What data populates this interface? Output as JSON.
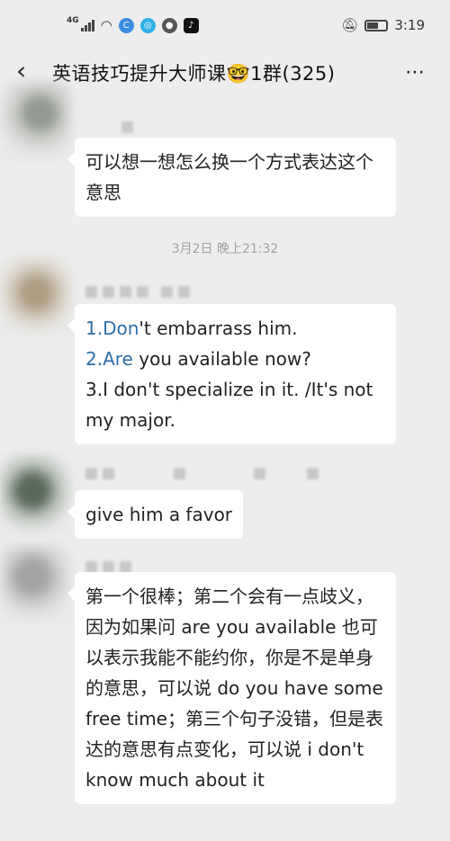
{
  "status_bar": {
    "network": "4G",
    "time": "3:19"
  },
  "header": {
    "title": "英语技巧提升大师课🤓1群(325)"
  },
  "messages": [
    {
      "text": "可以想一想怎么换一个方式表达这个意思"
    },
    {
      "timestamp": "3月2日 晚上21:32"
    },
    {
      "lines": [
        {
          "num": "1.",
          "blue": "Don",
          "rest": "'t embarrass him."
        },
        {
          "num": "2.",
          "blue": "Are",
          "rest": " you available now?"
        },
        {
          "num": "",
          "blue": "",
          "rest": "3.I don't specialize in it. /It's not my major."
        }
      ]
    },
    {
      "text": "give him a favor"
    },
    {
      "text": "第一个很棒；第二个会有一点歧义，因为如果问 are you available 也可以表示我能不能约你，你是不是单身的意思，可以说 do you have some free time；第三个句子没错，但是表达的意思有点变化，可以说 i don't know much about it"
    }
  ],
  "colors": {
    "background": "#ededed",
    "bubble": "#ffffff",
    "highlight": "#2f6ea8"
  }
}
